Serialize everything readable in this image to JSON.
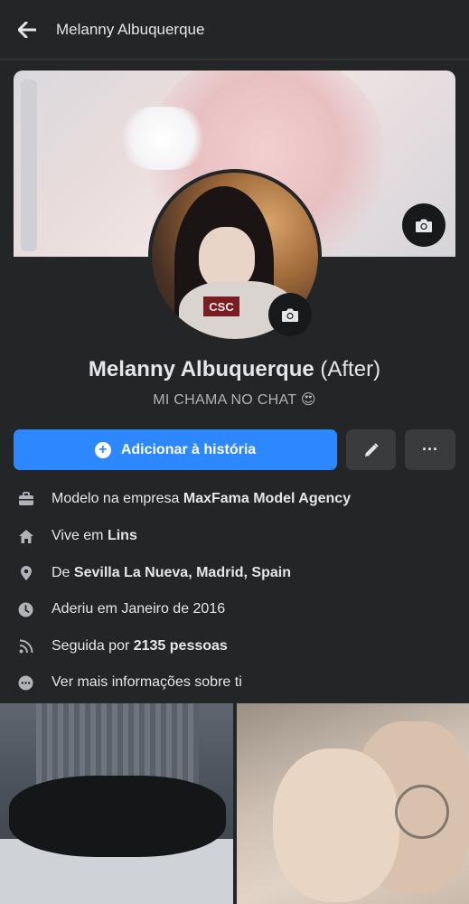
{
  "header": {
    "title": "Melanny Albuquerque"
  },
  "profile": {
    "name": "Melanny Albuquerque",
    "alternate_name": "(After)",
    "bio": "MI CHAMA NO CHAT 😍",
    "avatar_shirt_text": "CSC"
  },
  "actions": {
    "add_story_label": "Adicionar à história",
    "more_label": "···"
  },
  "details": {
    "work_prefix": "Modelo na empresa ",
    "work_company": "MaxFama Model Agency",
    "lives_prefix": "Vive em ",
    "lives_city": "Lins",
    "from_prefix": "De ",
    "from_place": "Sevilla La Nueva, Madrid, Spain",
    "joined": "Aderiu em Janeiro de 2016",
    "followers_prefix": "Seguida por ",
    "followers_count": "2135 pessoas",
    "see_more": "Ver mais informações sobre ti"
  },
  "icons": {
    "back": "arrow-left-icon",
    "camera": "camera-icon",
    "edit": "pencil-icon",
    "work": "briefcase-icon",
    "home": "home-icon",
    "location": "location-pin-icon",
    "clock": "clock-icon",
    "followers": "rss-icon",
    "more": "more-dots-icon"
  },
  "colors": {
    "background": "#242526",
    "primary": "#2d88ff",
    "secondary_button": "#3a3b3c",
    "text": "#e4e6eb",
    "muted_text": "#b0b3b8"
  }
}
